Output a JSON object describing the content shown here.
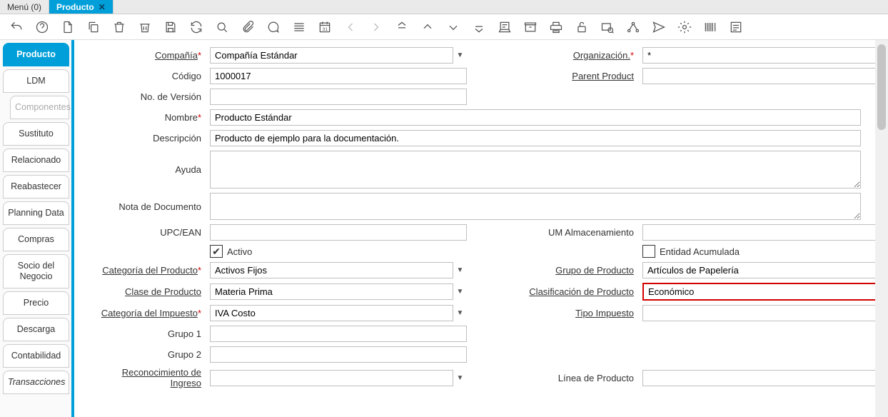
{
  "tabs": {
    "menu": "Menú (0)",
    "producto": "Producto"
  },
  "sideTabs": {
    "producto": "Producto",
    "ldm": "LDM",
    "componentes": "Componentes",
    "sustituto": "Sustituto",
    "relacionado": "Relacionado",
    "reabastecer": "Reabastecer",
    "planning": "Planning Data",
    "compras": "Compras",
    "socio": "Socio del Negocio",
    "precio": "Precio",
    "descarga": "Descarga",
    "contabilidad": "Contabilidad",
    "transacciones": "Transacciones"
  },
  "labels": {
    "compania": "Compañía",
    "organizacion": "Organización.",
    "codigo": "Código",
    "parentProduct": "Parent Product",
    "noVersion": "No. de Versión",
    "nombre": "Nombre",
    "descripcion": "Descripción",
    "ayuda": "Ayuda",
    "notaDoc": "Nota de Documento",
    "upc": "UPC/EAN",
    "umAlm": "UM Almacenamiento",
    "activo": "Activo",
    "entidadAcum": "Entidad Acumulada",
    "catProducto": "Categoría del Producto",
    "grupoProducto": "Grupo de Producto",
    "claseProducto": "Clase de Producto",
    "clasifProducto": "Clasificación de Producto",
    "catImpuesto": "Categoría del Impuesto",
    "tipoImpuesto": "Tipo Impuesto",
    "grupo1": "Grupo 1",
    "grupo2": "Grupo 2",
    "reconIngreso": "Reconocimiento de Ingreso",
    "lineaProducto": "Línea de Producto"
  },
  "values": {
    "compania": "Compañía Estándar",
    "organizacion": "*",
    "codigo": "1000017",
    "parentProduct": "",
    "noVersion": "",
    "nombre": "Producto Estándar",
    "descripcion": "Producto de ejemplo para la documentación.",
    "ayuda": "",
    "notaDoc": "",
    "upc": "",
    "umAlm": "",
    "catProducto": "Activos Fijos",
    "grupoProducto": "Artículos de Papelería",
    "claseProducto": "Materia Prima",
    "clasifProducto": "Económico",
    "catImpuesto": "IVA Costo",
    "tipoImpuesto": "",
    "grupo1": "",
    "grupo2": "",
    "reconIngreso": "",
    "lineaProducto": ""
  }
}
